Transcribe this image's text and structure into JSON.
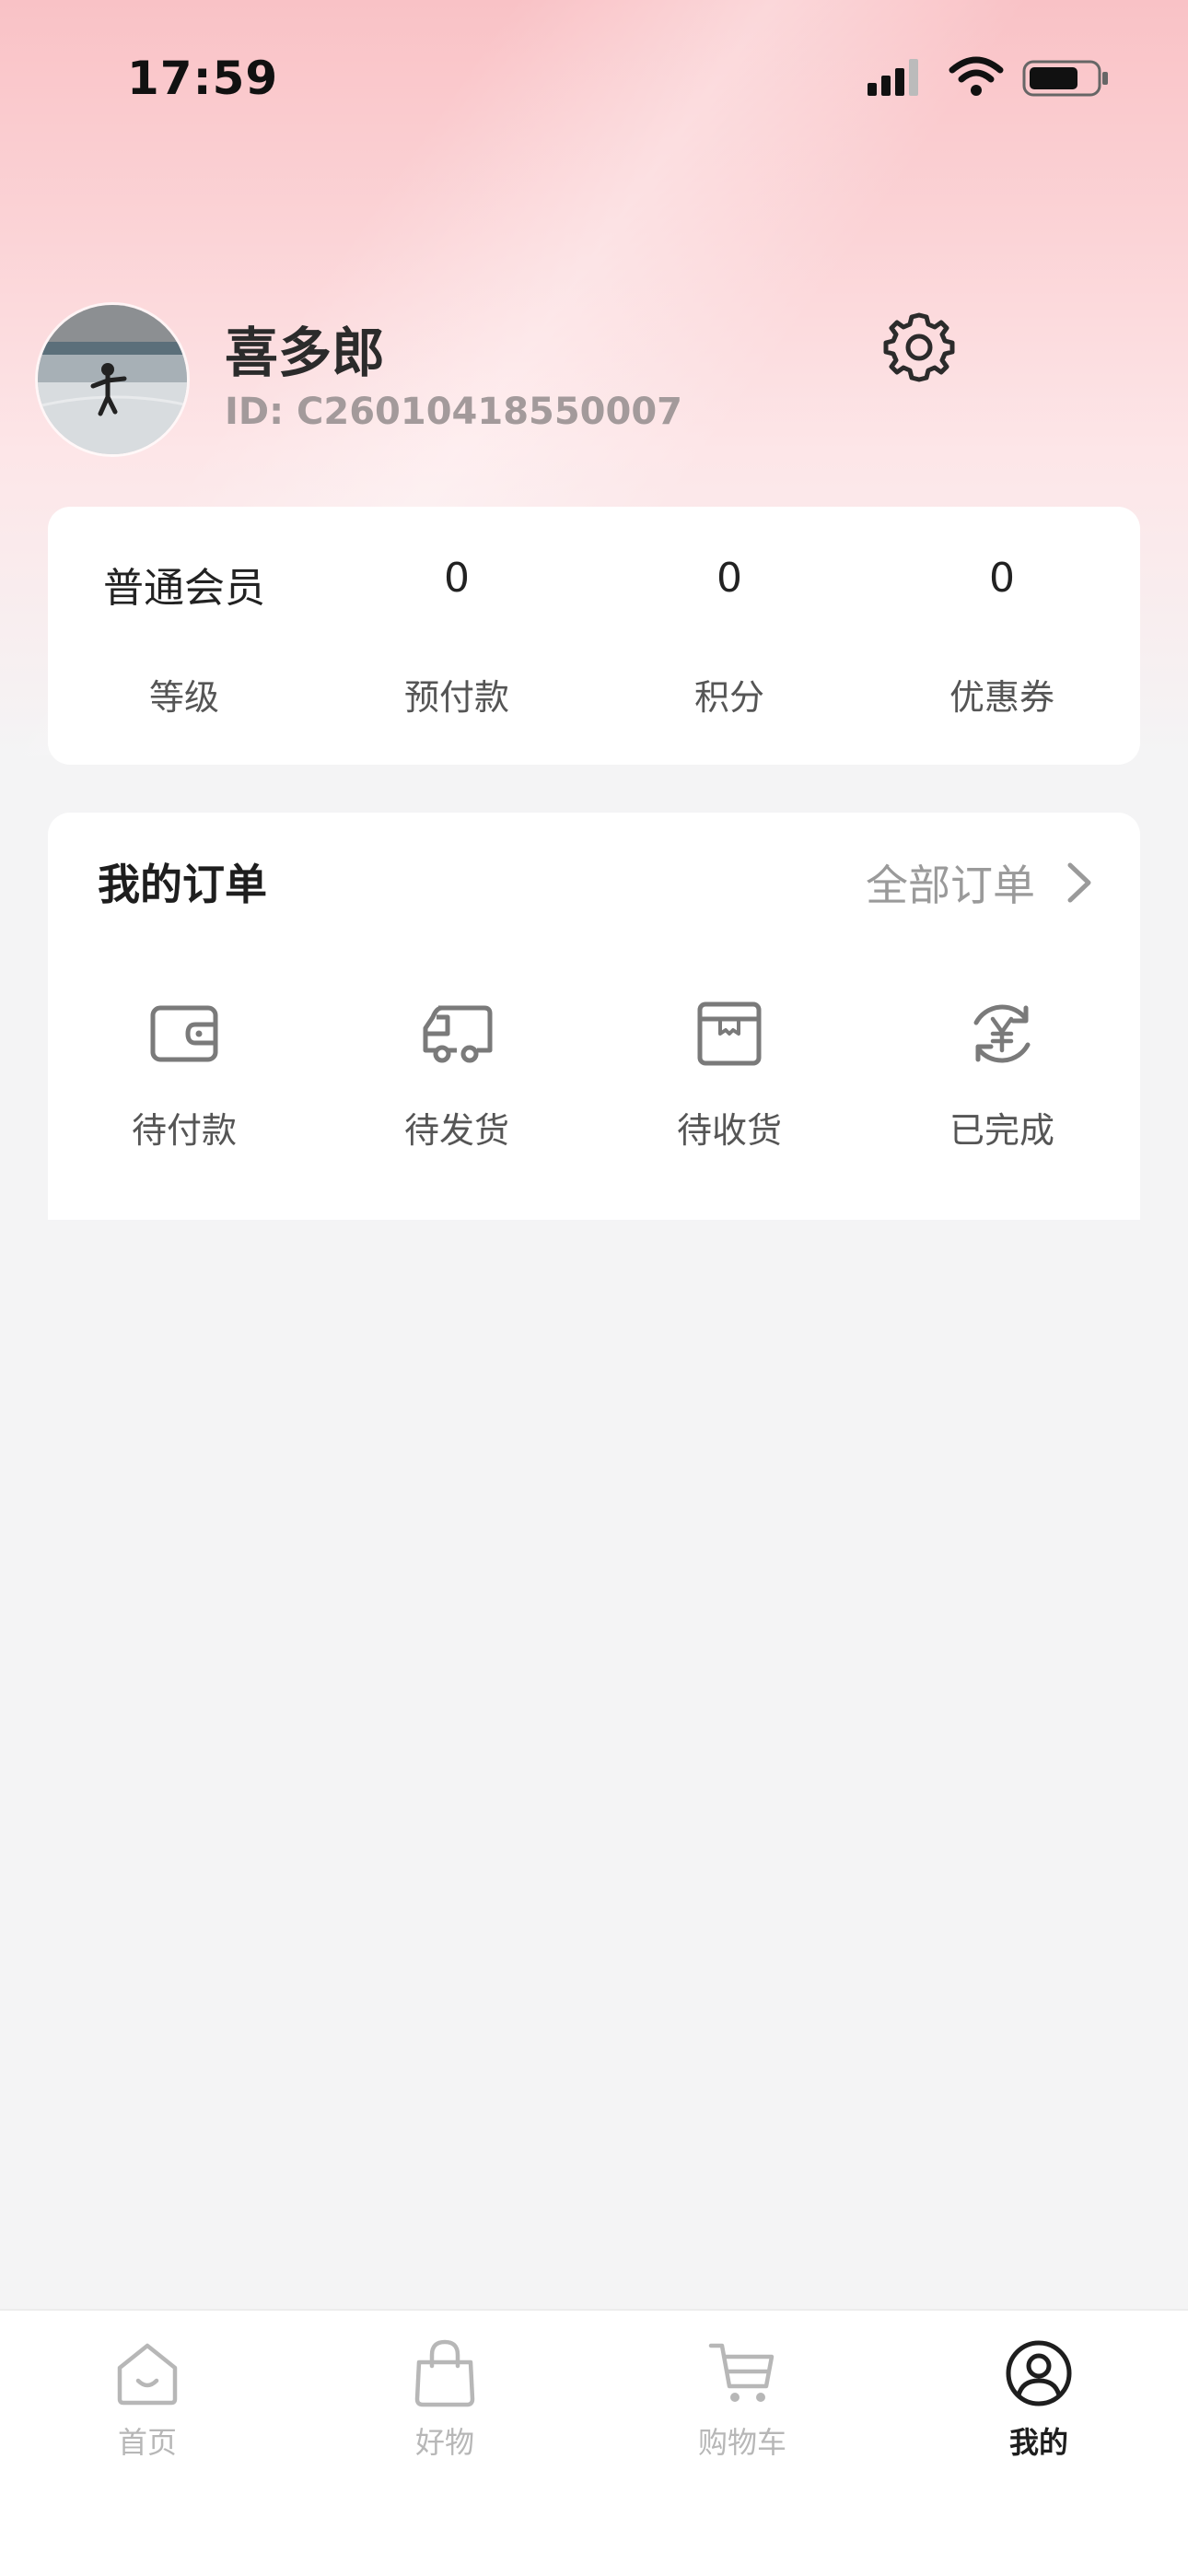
{
  "status_bar": {
    "time": "17:59"
  },
  "profile": {
    "nickname": "喜多郎",
    "id_text": "ID: C26010418550007"
  },
  "stats": [
    {
      "value": "普通会员",
      "label": "等级"
    },
    {
      "value": "0",
      "label": "预付款"
    },
    {
      "value": "0",
      "label": "积分"
    },
    {
      "value": "0",
      "label": "优惠券"
    }
  ],
  "orders": {
    "title": "我的订单",
    "all_label": "全部订单",
    "items": [
      {
        "label": "待付款",
        "icon": "wallet-icon"
      },
      {
        "label": "待发货",
        "icon": "truck-icon"
      },
      {
        "label": "待收货",
        "icon": "package-icon"
      },
      {
        "label": "已完成",
        "icon": "yen-refresh-icon"
      }
    ]
  },
  "tabs": [
    {
      "label": "首页",
      "icon": "home-icon",
      "active": false
    },
    {
      "label": "好物",
      "icon": "bag-icon",
      "active": false
    },
    {
      "label": "购物车",
      "icon": "cart-icon",
      "active": false
    },
    {
      "label": "我的",
      "icon": "user-icon",
      "active": true
    }
  ],
  "colors": {
    "hero_pink": "#f9c2c6",
    "background": "#f4f4f5",
    "icon_gray": "#7a7a7a",
    "tab_inactive": "#b7b7b7",
    "tab_active": "#1e1e1e"
  }
}
